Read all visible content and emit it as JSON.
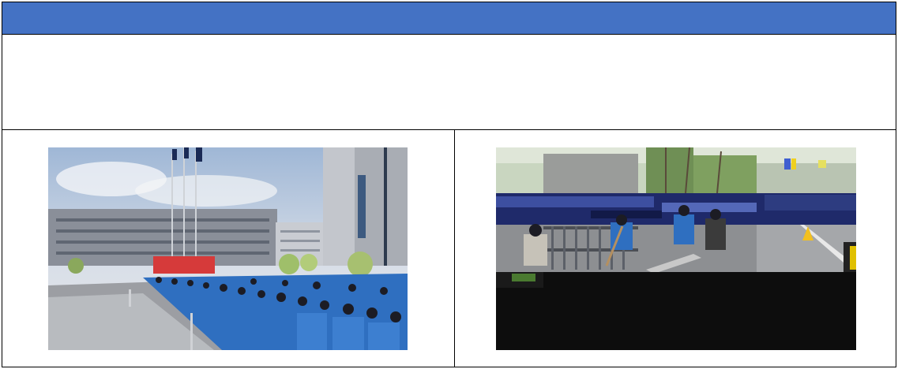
{
  "document": {
    "header": {
      "color": "#4472c4",
      "text": ""
    },
    "body_row": {
      "text": ""
    },
    "photos": [
      {
        "subject": "crowd-in-blue-uniforms-flag-raising",
        "banner_color": "#d63a3a"
      },
      {
        "subject": "workers-sweeping-roadside",
        "dominant_colors": [
          "#2a2f3a",
          "#0d0d0d",
          "#2f6fc0"
        ]
      }
    ]
  }
}
